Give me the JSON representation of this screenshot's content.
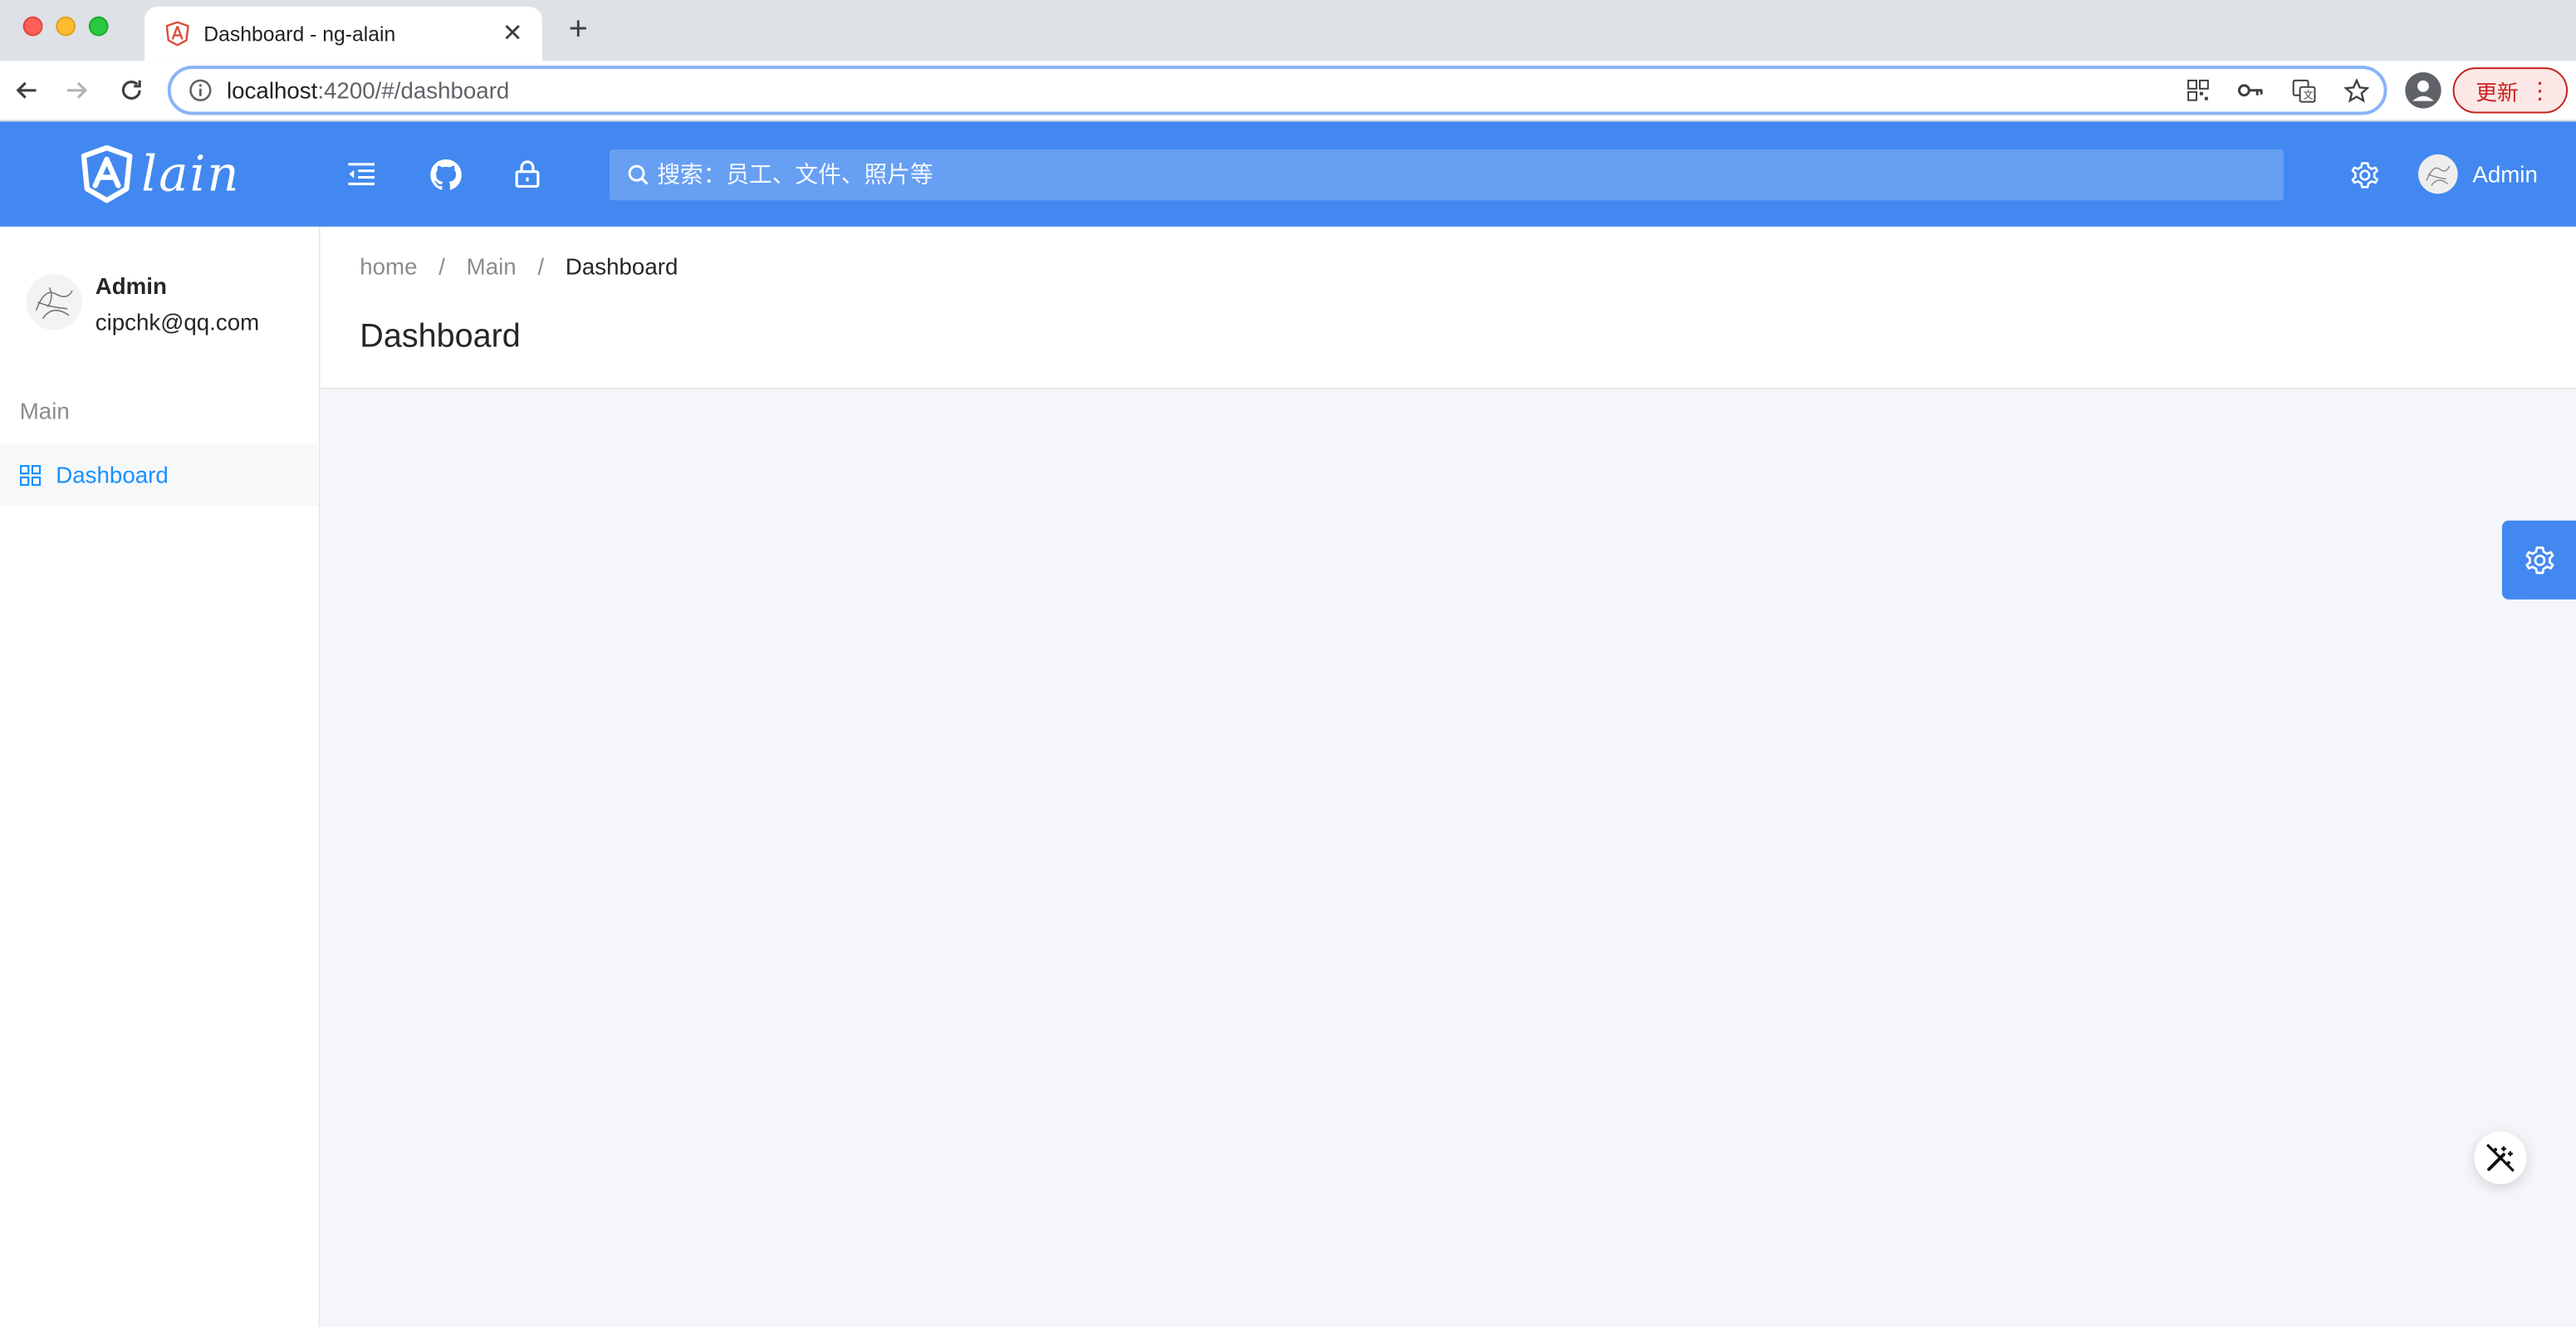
{
  "browser": {
    "tab_title": "Dashboard - ng-alain",
    "url_host": "localhost",
    "url_path": ":4200/#/dashboard",
    "update_label": "更新"
  },
  "header": {
    "logo_text": "lain",
    "search_placeholder": "搜索：员工、文件、照片等",
    "user_name": "Admin",
    "brand_color": "#4288f0"
  },
  "sidebar": {
    "user": {
      "name": "Admin",
      "email": "cipchk@qq.com"
    },
    "groups": [
      {
        "title": "Main",
        "items": [
          {
            "label": "Dashboard",
            "icon": "appstore-icon",
            "active": true
          }
        ]
      }
    ]
  },
  "page": {
    "breadcrumb": [
      "home",
      "Main",
      "Dashboard"
    ],
    "title": "Dashboard"
  }
}
